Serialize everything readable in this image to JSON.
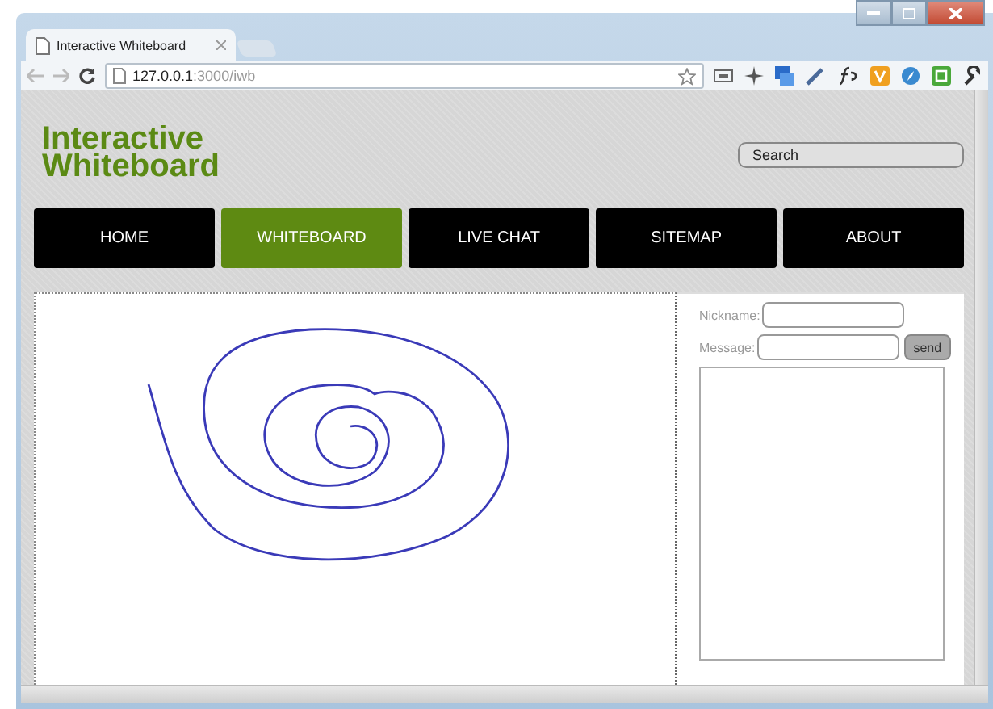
{
  "browser": {
    "tab_title": "Interactive Whiteboard",
    "url": {
      "host": "127.0.0.1",
      "path": ":3000/iwb"
    }
  },
  "site": {
    "logo": "Interactive Whiteboard",
    "search": {
      "placeholder": "Search"
    }
  },
  "nav": [
    {
      "label": "HOME",
      "selected": false
    },
    {
      "label": "WHITEBOARD",
      "selected": true
    },
    {
      "label": "LIVE CHAT",
      "selected": false
    },
    {
      "label": "SITEMAP",
      "selected": false
    },
    {
      "label": "ABOUT",
      "selected": false
    }
  ],
  "chat": {
    "nickname_label": "Nickname:",
    "message_label": "Message:",
    "send_button": "send"
  }
}
